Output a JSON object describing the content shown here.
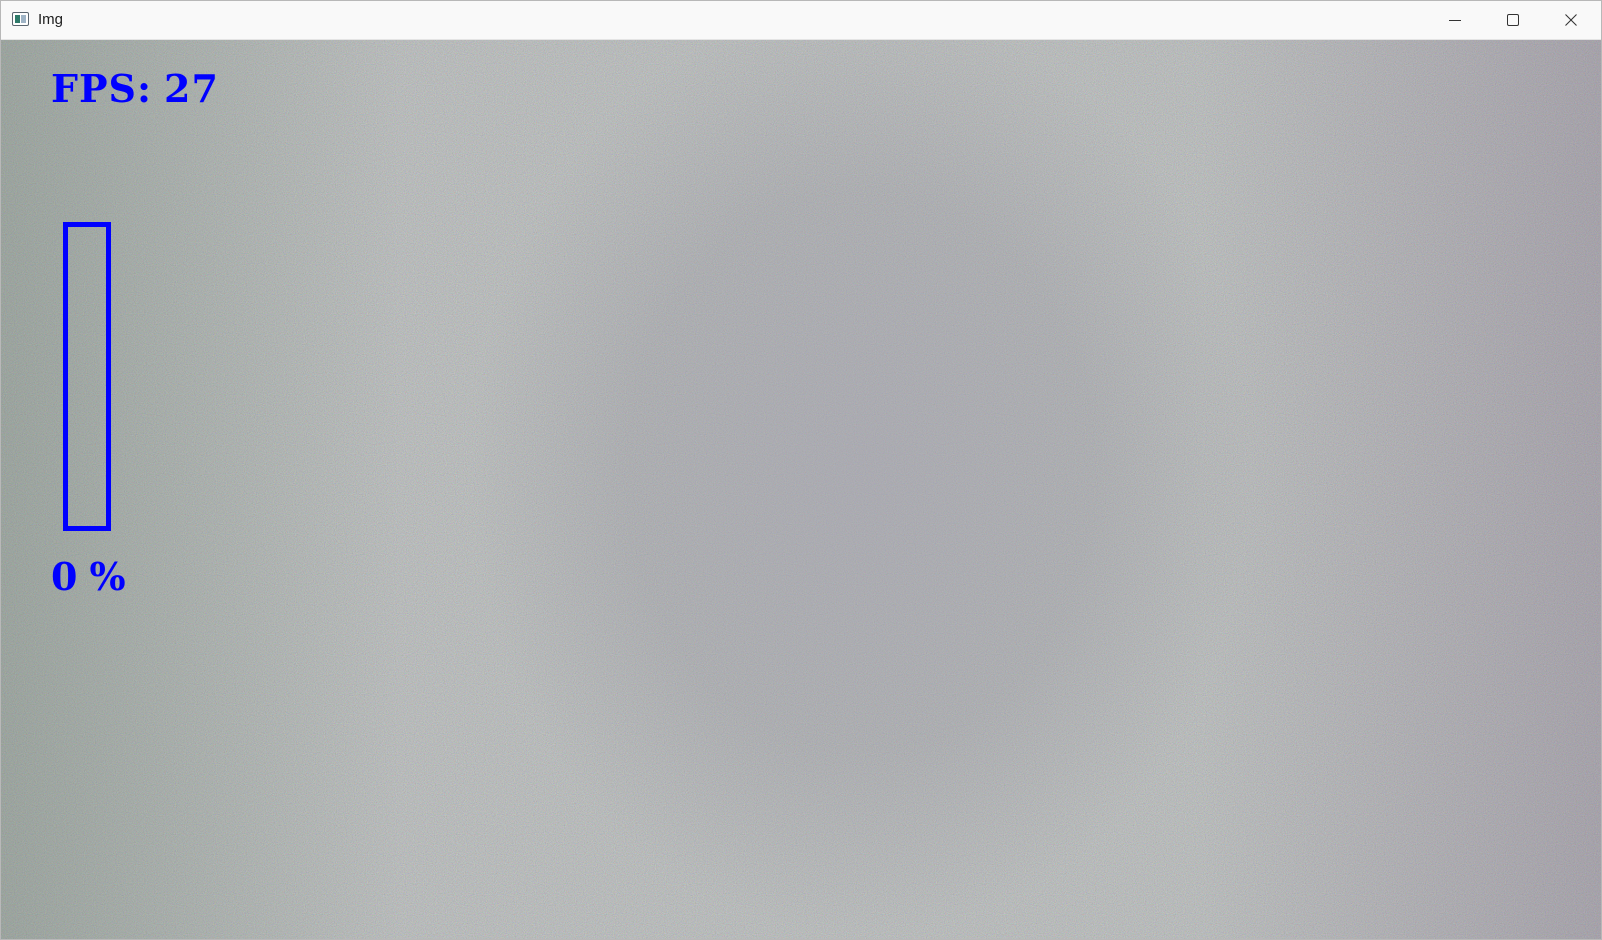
{
  "window": {
    "title": "Img",
    "icon": "opencv-window-icon",
    "controls": {
      "minimize_icon": "minimize-icon",
      "maximize_icon": "maximize-icon",
      "close_icon": "close-icon"
    }
  },
  "overlay": {
    "color": "#0000ff",
    "fps_label": "FPS:",
    "fps_value": "27",
    "progress_value": "0",
    "progress_unit": "%",
    "progress_fraction": 0
  }
}
